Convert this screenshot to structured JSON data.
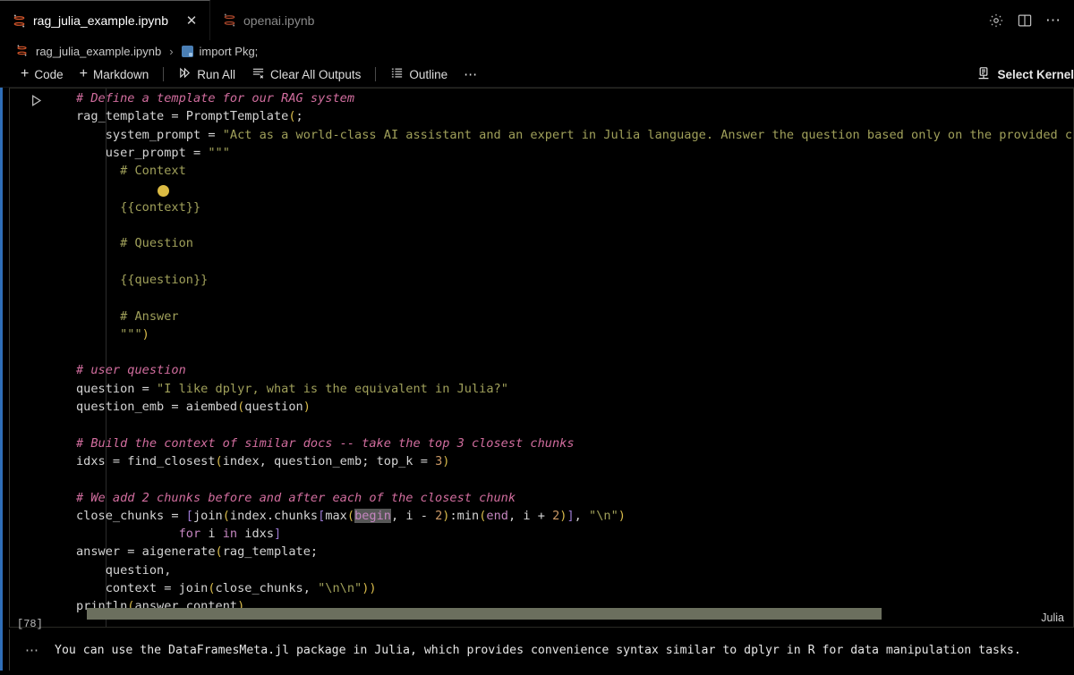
{
  "window": {
    "title_actions": [
      {
        "name": "settings-gear-icon",
        "label": "Settings"
      },
      {
        "name": "split-editor-icon",
        "label": "Split Editor"
      },
      {
        "name": "more-actions-icon",
        "label": "More Actions..."
      }
    ]
  },
  "tabs": [
    {
      "label": "rag_julia_example.ipynb",
      "icon": "notebook-icon",
      "active": true,
      "close": "✕"
    },
    {
      "label": "openai.ipynb",
      "icon": "notebook-icon",
      "active": false,
      "close": "✕"
    }
  ],
  "breadcrumb": {
    "file": "rag_julia_example.ipynb",
    "separator": "›",
    "cell": "import Pkg;"
  },
  "toolbar": {
    "add_code": "Code",
    "add_markdown": "Markdown",
    "run_all": "Run All",
    "clear_all_outputs": "Clear All Outputs",
    "outline": "Outline",
    "more": "⋯",
    "plus": "+",
    "select_kernel": "Select Kernel"
  },
  "cell": {
    "execution_count": "[78]",
    "language": "Julia",
    "run_button_label": "Execute Cell",
    "code_lines": [
      [
        {
          "t": "# Define a template for our RAG system",
          "c": "cm"
        }
      ],
      [
        {
          "t": "rag_template ",
          "c": "id"
        },
        {
          "t": "= ",
          "c": "op"
        },
        {
          "t": "PromptTemplate",
          "c": "fn"
        },
        {
          "t": "(",
          "c": "pa"
        },
        {
          "t": ";",
          "c": "op"
        }
      ],
      [
        {
          "t": "    system_prompt ",
          "c": "id"
        },
        {
          "t": "= ",
          "c": "op"
        },
        {
          "t": "\"Act as a world-class AI assistant and an expert in Julia language. Answer the question based only on the provided conte",
          "c": "st"
        }
      ],
      [
        {
          "t": "    user_prompt ",
          "c": "id"
        },
        {
          "t": "= ",
          "c": "op"
        },
        {
          "t": "\"\"\"",
          "c": "st"
        }
      ],
      [
        {
          "t": "      # Context",
          "c": "st"
        }
      ],
      [
        {
          "t": "",
          "c": "st"
        }
      ],
      [
        {
          "t": "      {{context}}",
          "c": "st"
        }
      ],
      [
        {
          "t": "",
          "c": "st"
        }
      ],
      [
        {
          "t": "      # Question",
          "c": "st"
        }
      ],
      [
        {
          "t": "",
          "c": "st"
        }
      ],
      [
        {
          "t": "      {{question}}",
          "c": "st"
        }
      ],
      [
        {
          "t": "",
          "c": "st"
        }
      ],
      [
        {
          "t": "      # Answer",
          "c": "st"
        }
      ],
      [
        {
          "t": "      \"\"\"",
          "c": "st"
        },
        {
          "t": ")",
          "c": "pa"
        }
      ],
      [
        {
          "t": "",
          "c": "id"
        }
      ],
      [
        {
          "t": "# user question",
          "c": "cm"
        }
      ],
      [
        {
          "t": "question ",
          "c": "id"
        },
        {
          "t": "= ",
          "c": "op"
        },
        {
          "t": "\"I like dplyr, what is the equivalent in Julia?\"",
          "c": "st"
        }
      ],
      [
        {
          "t": "question_emb ",
          "c": "id"
        },
        {
          "t": "= ",
          "c": "op"
        },
        {
          "t": "aiembed",
          "c": "fn"
        },
        {
          "t": "(",
          "c": "pa"
        },
        {
          "t": "question",
          "c": "id"
        },
        {
          "t": ")",
          "c": "pa"
        }
      ],
      [
        {
          "t": "",
          "c": "id"
        }
      ],
      [
        {
          "t": "# Build the context of similar docs -- take the top 3 closest chunks",
          "c": "cm"
        }
      ],
      [
        {
          "t": "idxs ",
          "c": "id"
        },
        {
          "t": "= ",
          "c": "op"
        },
        {
          "t": "find_closest",
          "c": "fn"
        },
        {
          "t": "(",
          "c": "pa"
        },
        {
          "t": "index, question_emb; top_k ",
          "c": "id"
        },
        {
          "t": "= ",
          "c": "op"
        },
        {
          "t": "3",
          "c": "nu"
        },
        {
          "t": ")",
          "c": "pa"
        }
      ],
      [
        {
          "t": "",
          "c": "id"
        }
      ],
      [
        {
          "t": "# We add 2 chunks before and after each of the closest chunk",
          "c": "cm"
        }
      ],
      [
        {
          "t": "close_chunks ",
          "c": "id"
        },
        {
          "t": "= ",
          "c": "op"
        },
        {
          "t": "[",
          "c": "br"
        },
        {
          "t": "join",
          "c": "fn"
        },
        {
          "t": "(",
          "c": "pa"
        },
        {
          "t": "index.chunks",
          "c": "id"
        },
        {
          "t": "[",
          "c": "br"
        },
        {
          "t": "max",
          "c": "fn"
        },
        {
          "t": "(",
          "c": "pa"
        },
        {
          "t": "begin",
          "c": "kw hl"
        },
        {
          "t": ", i ",
          "c": "id"
        },
        {
          "t": "- ",
          "c": "op"
        },
        {
          "t": "2",
          "c": "nu"
        },
        {
          "t": ")",
          "c": "pa"
        },
        {
          "t": ":",
          "c": "op"
        },
        {
          "t": "min",
          "c": "fn"
        },
        {
          "t": "(",
          "c": "pa"
        },
        {
          "t": "end",
          "c": "kw"
        },
        {
          "t": ", i ",
          "c": "id"
        },
        {
          "t": "+ ",
          "c": "op"
        },
        {
          "t": "2",
          "c": "nu"
        },
        {
          "t": ")",
          "c": "pa"
        },
        {
          "t": "]",
          "c": "br"
        },
        {
          "t": ", ",
          "c": "id"
        },
        {
          "t": "\"\\n\"",
          "c": "st"
        },
        {
          "t": ")",
          "c": "pa"
        }
      ],
      [
        {
          "t": "              ",
          "c": "id"
        },
        {
          "t": "for ",
          "c": "kw"
        },
        {
          "t": "i ",
          "c": "id"
        },
        {
          "t": "in ",
          "c": "kw"
        },
        {
          "t": "idxs",
          "c": "id"
        },
        {
          "t": "]",
          "c": "br"
        }
      ],
      [
        {
          "t": "answer ",
          "c": "id"
        },
        {
          "t": "= ",
          "c": "op"
        },
        {
          "t": "aigenerate",
          "c": "fn"
        },
        {
          "t": "(",
          "c": "pa"
        },
        {
          "t": "rag_template",
          "c": "id"
        },
        {
          "t": ";",
          "c": "op"
        }
      ],
      [
        {
          "t": "    question,",
          "c": "id"
        }
      ],
      [
        {
          "t": "    context ",
          "c": "id"
        },
        {
          "t": "= ",
          "c": "op"
        },
        {
          "t": "join",
          "c": "fn"
        },
        {
          "t": "(",
          "c": "pa"
        },
        {
          "t": "close_chunks, ",
          "c": "id"
        },
        {
          "t": "\"\\n\\n\"",
          "c": "st"
        },
        {
          "t": ")",
          "c": "pa"
        },
        {
          "t": ")",
          "c": "pa"
        }
      ],
      [
        {
          "t": "println",
          "c": "fn"
        },
        {
          "t": "(",
          "c": "pa"
        },
        {
          "t": "answer.content",
          "c": "id"
        },
        {
          "t": ")",
          "c": "pa"
        }
      ]
    ]
  },
  "output": {
    "more": "⋯",
    "text": "You can use the DataFramesMeta.jl package in Julia, which provides convenience syntax similar to dplyr in R for data manipulation tasks."
  },
  "colors": {
    "background": "#000000",
    "comment": "#d16d9e",
    "string": "#a0a05a",
    "keyword": "#c586c0",
    "number": "#cc9a66",
    "paren": "#d7ba4a",
    "bracket": "#9a78d0",
    "identifier": "#d4d4d4",
    "focus_accent": "#2f6fb8",
    "scrollbar": "#6b6f5e",
    "highlight": "#575757"
  }
}
